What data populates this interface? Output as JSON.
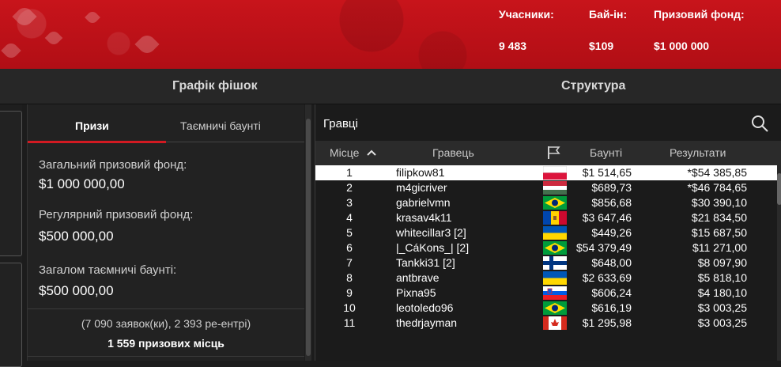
{
  "banner": {
    "stats": [
      {
        "label": "Учасники:",
        "value": "9 483"
      },
      {
        "label": "Бай-ін:",
        "value": "$109"
      },
      {
        "label": "Призовий фонд:",
        "value": "$1 000 000"
      }
    ]
  },
  "tabs": {
    "chip_graph": "Графік фішок",
    "structure": "Структура"
  },
  "prizes": {
    "tab_prizes": "Призи",
    "tab_mystery": "Таємничі баунті",
    "total_label": "Загальний призовий фонд:",
    "total_value": "$1 000 000,00",
    "regular_label": "Регулярний призовий фонд:",
    "regular_value": "$500 000,00",
    "mystery_label": "Загалом таємничі баунті:",
    "mystery_value": "$500 000,00",
    "summary": "(7 090 заявок(ки), 2 393 ре-ентрі)",
    "paid_places": "1 559 призових місць"
  },
  "players": {
    "title": "Гравці",
    "columns": {
      "place": "Місце",
      "player": "Гравець",
      "bounty": "Баунті",
      "results": "Результати"
    },
    "rows": [
      {
        "place": "1",
        "name": "filipkow81",
        "flag": "poland",
        "bounty": "$1 514,65",
        "result": "*$54 385,85"
      },
      {
        "place": "2",
        "name": "m4gicriver",
        "flag": "hungary",
        "bounty": "$689,73",
        "result": "*$46 784,65"
      },
      {
        "place": "3",
        "name": "gabrielvmn",
        "flag": "brazil",
        "bounty": "$856,68",
        "result": "$30 390,10"
      },
      {
        "place": "4",
        "name": "krasav4k11",
        "flag": "moldova",
        "bounty": "$3 647,46",
        "result": "$21 834,50"
      },
      {
        "place": "5",
        "name": "whitecillar3 [2]",
        "flag": "ukraine",
        "bounty": "$449,26",
        "result": "$15 687,50"
      },
      {
        "place": "6",
        "name": "|_CáKons_| [2]",
        "flag": "brazil",
        "bounty": "$54 379,49",
        "result": "$11 271,00"
      },
      {
        "place": "7",
        "name": "Tankki31 [2]",
        "flag": "finland",
        "bounty": "$648,00",
        "result": "$8 097,90"
      },
      {
        "place": "8",
        "name": "antbrave",
        "flag": "ukraine",
        "bounty": "$2 633,69",
        "result": "$5 818,10"
      },
      {
        "place": "9",
        "name": "Pixna95",
        "flag": "slovenia",
        "bounty": "$606,24",
        "result": "$4 180,10"
      },
      {
        "place": "10",
        "name": "leotoledo96",
        "flag": "brazil",
        "bounty": "$616,19",
        "result": "$3 003,25"
      },
      {
        "place": "11",
        "name": "thedrjayman",
        "flag": "canada",
        "bounty": "$1 295,98",
        "result": "$3 003,25"
      }
    ]
  },
  "colors": {
    "accent": "#d21a22",
    "banner": "#c8141b"
  }
}
